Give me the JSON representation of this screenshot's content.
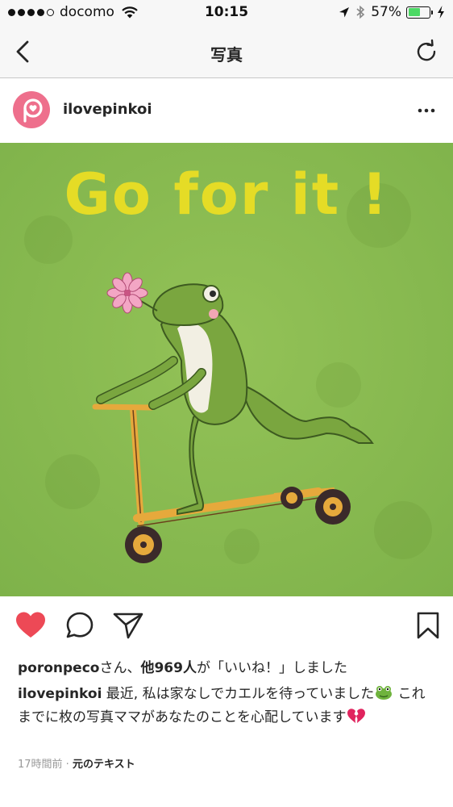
{
  "status_bar": {
    "carrier": "docomo",
    "time": "10:15",
    "battery_percent": "57%",
    "battery_level": 0.57
  },
  "nav": {
    "title": "写真",
    "back_icon": "chevron-left-icon",
    "refresh_icon": "refresh-icon"
  },
  "post": {
    "username": "ilovepinkoi",
    "more_icon": "more-dots-icon",
    "image": {
      "headline": "Go for it !",
      "background_color": "#8cbd4f",
      "headline_color": "#e5dc26"
    },
    "actions": {
      "like_icon": "heart-filled-icon",
      "comment_icon": "comment-icon",
      "share_icon": "direct-share-icon",
      "save_icon": "bookmark-icon",
      "liked": true,
      "like_color": "#ed4956"
    },
    "likes": {
      "first_user": "poronpeco",
      "san": "さん、",
      "others": "他969人",
      "rest": "が「いいね！」しました"
    },
    "caption": {
      "username": "ilovepinkoi",
      "part1": " 最近, 私は家なしでカエルを待っていました",
      "part2": " これまでに枚の写真ママがあなたのことを心配しています"
    },
    "timestamp": "17時間前",
    "separator": " · ",
    "translate_label": "元のテキスト"
  }
}
